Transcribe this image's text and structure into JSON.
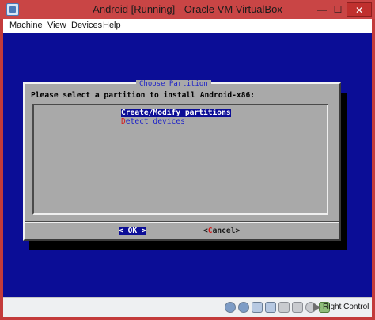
{
  "window": {
    "title": "Android [Running] - Oracle VM VirtualBox",
    "minimize_glyph": "—",
    "maximize_glyph": "☐",
    "close_glyph": "✕"
  },
  "menu": {
    "items": [
      "Machine",
      "View",
      "Devices",
      "Help"
    ]
  },
  "dialog": {
    "title": "Choose Partition",
    "prompt": "Please select a partition to install Android-x86:",
    "options": [
      {
        "hotkey": "C",
        "rest": "reate/Modify partitions",
        "selected": true
      },
      {
        "hotkey": "D",
        "rest": "etect devices",
        "selected": false
      }
    ],
    "ok_button": {
      "left": "< ",
      "hotkey": "O",
      "rest": "K",
      "right": " >"
    },
    "cancel_button": {
      "left": "<",
      "hotkey": "C",
      "rest": "ancel",
      "right": ">"
    }
  },
  "statusbar": {
    "icons": [
      "hard-disk-icon",
      "optical-disk-icon",
      "usb-icon",
      "network-icon",
      "shared-folder-icon",
      "display-icon",
      "capture-icon",
      "mouse-integration-icon"
    ],
    "host_key": "Right Control"
  },
  "colors": {
    "vm_background": "#0b0d96",
    "dialog_background": "#a9a9a9",
    "title_bar": "#c94545",
    "highlight": "#0b0d96",
    "hotkey": "#d41c1c"
  }
}
